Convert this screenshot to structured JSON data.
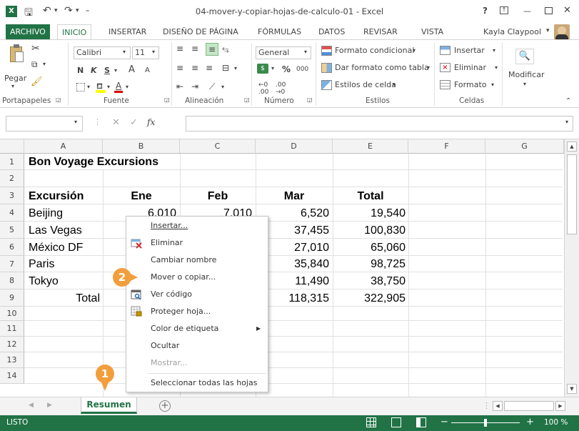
{
  "titlebar": {
    "title": "04-mover-y-copiar-hojas-de-calculo-01 - Excel",
    "help": "?",
    "minimize": "—",
    "close": "✕"
  },
  "tabs": [
    "ARCHIVO",
    "INICIO",
    "INSERTAR",
    "DISEÑO DE PÁGINA",
    "FÓRMULAS",
    "DATOS",
    "REVISAR",
    "VISTA"
  ],
  "user": "Kayla Claypool",
  "ribbon": {
    "paste_label": "Pegar",
    "font_name": "Calibri",
    "font_size": "11",
    "bold": "N",
    "italic": "K",
    "underline": "S",
    "grow": "A",
    "shrink": "A",
    "number_format": "General",
    "percent": "%",
    "thousands": "000",
    "cond_format": "Formato condicional",
    "table_format": "Dar formato como tabla",
    "cell_styles": "Estilos de celda",
    "insert": "Insertar",
    "delete": "Eliminar",
    "format": "Formato",
    "modify": "Modificar",
    "groups": {
      "clipboard": "Portapapeles",
      "font": "Fuente",
      "alignment": "Alineación",
      "number": "Número",
      "styles": "Estilos",
      "cells": "Celdas"
    }
  },
  "formula_bar": {
    "fx": "fx",
    "cancel": "✕",
    "enter": "✓",
    "name_box": "",
    "content": ""
  },
  "columns": [
    "A",
    "B",
    "C",
    "D",
    "E",
    "F",
    "G"
  ],
  "rows": [
    "1",
    "2",
    "3",
    "4",
    "5",
    "6",
    "7",
    "8",
    "9",
    "10",
    "11",
    "12",
    "13",
    "14"
  ],
  "sheet": {
    "title": "Bon Voyage Excursions",
    "headers": [
      "Excursión",
      "Ene",
      "Feb",
      "Mar",
      "Total"
    ],
    "data": [
      {
        "name": "Beijing",
        "b": "6,010",
        "c": "7,010",
        "d": "6,520",
        "e": "19,540"
      },
      {
        "name": "Las Vegas",
        "d": "37,455",
        "e": "100,830"
      },
      {
        "name": "México DF",
        "d": "27,010",
        "e": "65,060"
      },
      {
        "name": "Paris",
        "d": "35,840",
        "e": "98,725"
      },
      {
        "name": "Tokyo",
        "d": "11,490",
        "e": "38,750"
      }
    ],
    "total_label": "Total",
    "total_d": "118,315",
    "total_e": "322,905"
  },
  "context_menu": [
    {
      "label": "Insertar...",
      "icon": "",
      "disabled": false
    },
    {
      "label": "Eliminar",
      "icon": "delete-sheet-icon",
      "disabled": false
    },
    {
      "label": "Cambiar nombre",
      "icon": "",
      "disabled": false
    },
    {
      "label": "Mover o copiar...",
      "icon": "",
      "disabled": false
    },
    {
      "label": "Ver código",
      "icon": "view-code-icon",
      "disabled": false
    },
    {
      "label": "Proteger hoja...",
      "icon": "protect-sheet-icon",
      "disabled": false
    },
    {
      "label": "Color de etiqueta",
      "icon": "",
      "disabled": false,
      "submenu": true
    },
    {
      "label": "Ocultar",
      "icon": "",
      "disabled": false
    },
    {
      "label": "Mostrar...",
      "icon": "",
      "disabled": true
    },
    {
      "label": "Seleccionar todas las hojas",
      "icon": "",
      "disabled": false
    }
  ],
  "callouts": [
    "1",
    "2"
  ],
  "sheet_tab": "Resumen",
  "status": {
    "ready": "LISTO",
    "zoom": "100 %",
    "minus": "−",
    "plus": "+"
  },
  "colors": {
    "excel_green": "#217346",
    "callout_orange": "#f29e3d"
  }
}
